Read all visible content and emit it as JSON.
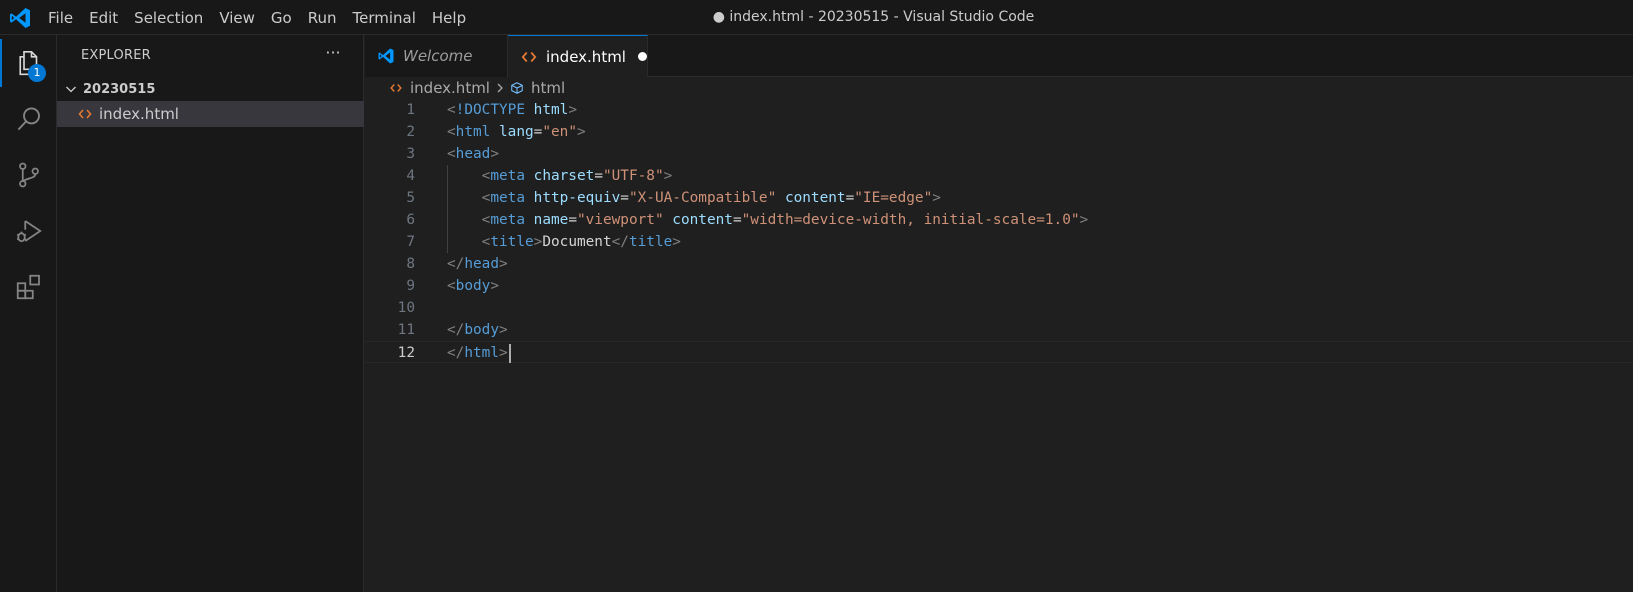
{
  "app": {
    "window_title": "● index.html - 20230515 - Visual Studio Code",
    "logo_icon": "vscode-logo-icon"
  },
  "menu": [
    "File",
    "Edit",
    "Selection",
    "View",
    "Go",
    "Run",
    "Terminal",
    "Help"
  ],
  "activity_bar": {
    "items": [
      {
        "name": "explorer",
        "icon": "files-icon",
        "badge": "1",
        "active": true
      },
      {
        "name": "search",
        "icon": "search-icon"
      },
      {
        "name": "source-control",
        "icon": "source-control-icon"
      },
      {
        "name": "run-debug",
        "icon": "run-debug-icon"
      },
      {
        "name": "extensions",
        "icon": "extensions-icon"
      }
    ]
  },
  "sidebar": {
    "title": "EXPLORER",
    "more_label": "···",
    "folder": "20230515",
    "files": [
      "index.html"
    ]
  },
  "tabs": [
    {
      "label": "Welcome",
      "icon": "vscode-logo-icon",
      "italic": true
    },
    {
      "label": "index.html",
      "icon": "html-file-icon",
      "dirty": true,
      "active": true
    }
  ],
  "breadcrumbs": {
    "file": "index.html",
    "symbol": "html"
  },
  "editor": {
    "current_line": 12,
    "lines": [
      {
        "n": "1",
        "tokens": [
          [
            "br",
            "<"
          ],
          [
            "tag",
            "!DOCTYPE"
          ],
          [
            "txt",
            " "
          ],
          [
            "attr",
            "html"
          ],
          [
            "br",
            ">"
          ]
        ]
      },
      {
        "n": "2",
        "tokens": [
          [
            "br",
            "<"
          ],
          [
            "tag",
            "html"
          ],
          [
            "txt",
            " "
          ],
          [
            "attr",
            "lang"
          ],
          [
            "txt",
            "="
          ],
          [
            "str",
            "\"en\""
          ],
          [
            "br",
            ">"
          ]
        ]
      },
      {
        "n": "3",
        "tokens": [
          [
            "br",
            "<"
          ],
          [
            "tag",
            "head"
          ],
          [
            "br",
            ">"
          ]
        ]
      },
      {
        "n": "4",
        "indent": "    ",
        "tokens": [
          [
            "br",
            "<"
          ],
          [
            "tag",
            "meta"
          ],
          [
            "txt",
            " "
          ],
          [
            "attr",
            "charset"
          ],
          [
            "txt",
            "="
          ],
          [
            "str",
            "\"UTF-8\""
          ],
          [
            "br",
            ">"
          ]
        ]
      },
      {
        "n": "5",
        "indent": "    ",
        "tokens": [
          [
            "br",
            "<"
          ],
          [
            "tag",
            "meta"
          ],
          [
            "txt",
            " "
          ],
          [
            "attr",
            "http-equiv"
          ],
          [
            "txt",
            "="
          ],
          [
            "str",
            "\"X-UA-Compatible\""
          ],
          [
            "txt",
            " "
          ],
          [
            "attr",
            "content"
          ],
          [
            "txt",
            "="
          ],
          [
            "str",
            "\"IE=edge\""
          ],
          [
            "br",
            ">"
          ]
        ]
      },
      {
        "n": "6",
        "indent": "    ",
        "tokens": [
          [
            "br",
            "<"
          ],
          [
            "tag",
            "meta"
          ],
          [
            "txt",
            " "
          ],
          [
            "attr",
            "name"
          ],
          [
            "txt",
            "="
          ],
          [
            "str",
            "\"viewport\""
          ],
          [
            "txt",
            " "
          ],
          [
            "attr",
            "content"
          ],
          [
            "txt",
            "="
          ],
          [
            "str",
            "\"width=device-width, initial-scale=1.0\""
          ],
          [
            "br",
            ">"
          ]
        ]
      },
      {
        "n": "7",
        "indent": "    ",
        "tokens": [
          [
            "br",
            "<"
          ],
          [
            "tag",
            "title"
          ],
          [
            "br",
            ">"
          ],
          [
            "txt",
            "Document"
          ],
          [
            "br",
            "</"
          ],
          [
            "tag",
            "title"
          ],
          [
            "br",
            ">"
          ]
        ]
      },
      {
        "n": "8",
        "tokens": [
          [
            "br",
            "</"
          ],
          [
            "tag",
            "head"
          ],
          [
            "br",
            ">"
          ]
        ]
      },
      {
        "n": "9",
        "tokens": [
          [
            "br",
            "<"
          ],
          [
            "tag",
            "body"
          ],
          [
            "br",
            ">"
          ]
        ]
      },
      {
        "n": "10",
        "tokens": []
      },
      {
        "n": "11",
        "tokens": [
          [
            "br",
            "</"
          ],
          [
            "tag",
            "body"
          ],
          [
            "br",
            ">"
          ]
        ]
      },
      {
        "n": "12",
        "tokens": [
          [
            "br",
            "</"
          ],
          [
            "tag",
            "html"
          ],
          [
            "br",
            ">"
          ]
        ]
      }
    ]
  },
  "colors": {
    "accent": "#0078d4",
    "html_icon": "#e37933",
    "vscode_blue": "#0098ff"
  }
}
